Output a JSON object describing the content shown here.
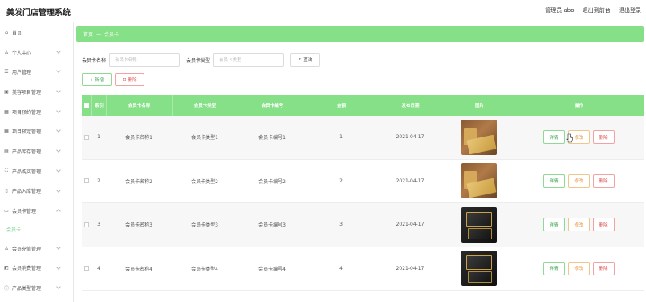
{
  "header": {
    "title": "美发门店管理系统",
    "admin": "管理员 abo",
    "exit_backend": "退出到前台",
    "logout": "退出登录"
  },
  "sidebar": {
    "items": [
      {
        "label": "首页",
        "icon": "home-icon",
        "glyph": "⌂"
      },
      {
        "label": "个人中心",
        "icon": "user-icon",
        "glyph": "♙"
      },
      {
        "label": "用户管理",
        "icon": "list-icon",
        "glyph": "☰"
      },
      {
        "label": "美容项目管理",
        "icon": "card-icon",
        "glyph": "▣"
      },
      {
        "label": "项目预约管理",
        "icon": "calendar-icon",
        "glyph": "▦"
      },
      {
        "label": "项目预定管理",
        "icon": "grid-icon",
        "glyph": "▦"
      },
      {
        "label": "产品库存管理",
        "icon": "box-icon",
        "glyph": "▤"
      },
      {
        "label": "产品购买管理",
        "icon": "frame-icon",
        "glyph": "⛶"
      },
      {
        "label": "产品入库管理",
        "icon": "lock-icon",
        "glyph": "▯"
      },
      {
        "label": "会员卡管理",
        "icon": "member-card-icon",
        "glyph": "▭"
      }
    ],
    "active_sub": "会员卡",
    "items_after": [
      {
        "label": "会员充值管理",
        "icon": "recharge-icon",
        "glyph": "♙"
      },
      {
        "label": "会员消费管理",
        "icon": "chart-icon",
        "glyph": "◩"
      },
      {
        "label": "产品类型管理",
        "icon": "info-icon",
        "glyph": "ⓘ"
      }
    ]
  },
  "breadcrumb": {
    "home": "首页",
    "separator": "一",
    "current": "会员卡"
  },
  "search": {
    "name_label": "会员卡名称",
    "name_placeholder": "会员卡名称",
    "type_label": "会员卡类型",
    "type_placeholder": "会员卡类型",
    "query_button": "查询"
  },
  "actions": {
    "add": "+ 新增",
    "delete": "删除"
  },
  "table": {
    "columns": [
      "索引",
      "会员卡名称",
      "会员卡类型",
      "会员卡编号",
      "金额",
      "发布日期",
      "图片",
      "操作"
    ],
    "rows": [
      {
        "index": "1",
        "name": "会员卡名称1",
        "type": "会员卡类型1",
        "number": "会员卡编号1",
        "amount": "1",
        "date": "2021-04-17",
        "image": "gold"
      },
      {
        "index": "2",
        "name": "会员卡名称2",
        "type": "会员卡类型2",
        "number": "会员卡编号2",
        "amount": "2",
        "date": "2021-04-17",
        "image": "gold"
      },
      {
        "index": "3",
        "name": "会员卡名称3",
        "type": "会员卡类型3",
        "number": "会员卡编号3",
        "amount": "3",
        "date": "2021-04-17",
        "image": "dark"
      },
      {
        "index": "4",
        "name": "会员卡名称4",
        "type": "会员卡类型4",
        "number": "会员卡编号4",
        "amount": "4",
        "date": "2021-04-17",
        "image": "dark"
      }
    ],
    "op_detail": "详情",
    "op_edit": "修改",
    "op_delete": "删除"
  },
  "colors": {
    "accent": "#85e087",
    "success": "#3ba54a",
    "warning": "#e6913c",
    "danger": "#e05656"
  }
}
